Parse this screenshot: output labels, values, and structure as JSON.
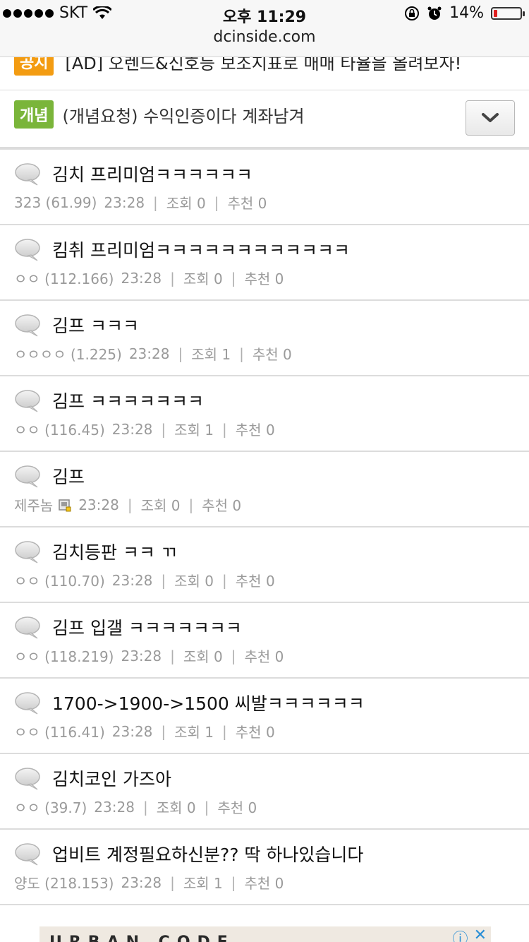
{
  "status": {
    "carrier": "SKT",
    "time": "오후 11:29",
    "battery_percent": "14%",
    "battery_level": 0.14,
    "url": "dcinside.com"
  },
  "notices": {
    "ad": {
      "tag": "공지",
      "text": "[AD] 오렌드&신호등 보조지표로 매매 타율을 올려보자!"
    },
    "concept": {
      "tag": "개념",
      "text": "(개념요청) 수익인증이다 계좌남겨"
    }
  },
  "posts": [
    {
      "title": "김치 프리미엄ㅋㅋㅋㅋㅋㅋ",
      "author": "323 (61.99)",
      "time": "23:28",
      "views": "조회 0",
      "likes": "추천 0"
    },
    {
      "title": "킴취 프리미엄ㅋㅋㅋㅋㅋㅋㅋㅋㅋㅋㅋㅋ",
      "author": "ㅇㅇ (112.166)",
      "time": "23:28",
      "views": "조회 0",
      "likes": "추천 0"
    },
    {
      "title": "김프 ㅋㅋㅋ",
      "author": "ㅇㅇㅇㅇ (1.225)",
      "time": "23:28",
      "views": "조회 1",
      "likes": "추천 0"
    },
    {
      "title": "김프 ㅋㅋㅋㅋㅋㅋㅋ",
      "author": "ㅇㅇ (116.45)",
      "time": "23:28",
      "views": "조회 1",
      "likes": "추천 0"
    },
    {
      "title": "김프",
      "author": "제주놈",
      "time": "23:28",
      "views": "조회 0",
      "likes": "추천 0"
    },
    {
      "title": "김치등판 ㅋㅋ ㄲ",
      "author": "ㅇㅇ (110.70)",
      "time": "23:28",
      "views": "조회 0",
      "likes": "추천 0"
    },
    {
      "title": "김프 입갤 ㅋㅋㅋㅋㅋㅋㅋ",
      "author": "ㅇㅇ (118.219)",
      "time": "23:28",
      "views": "조회 0",
      "likes": "추천 0"
    },
    {
      "title": "1700->1900->1500 씨발ㅋㅋㅋㅋㅋㅋ",
      "author": "ㅇㅇ (116.41)",
      "time": "23:28",
      "views": "조회 1",
      "likes": "추천 0"
    },
    {
      "title": "김치코인 가즈아",
      "author": "ㅇㅇ (39.7)",
      "time": "23:28",
      "views": "조회 0",
      "likes": "추천 0"
    },
    {
      "title": "업비트 계정필요하신분?? 딱 하나있습니다",
      "author": "양도 (218.153)",
      "time": "23:28",
      "views": "조회 1",
      "likes": "추천 0"
    }
  ],
  "bottom_ad": {
    "text": "URBAN CODE"
  },
  "colors": {
    "notice_tag": "#f39c12",
    "concept_tag": "#7ab53a",
    "meta_text": "#9a9a9a",
    "battery_low": "#e02020"
  }
}
